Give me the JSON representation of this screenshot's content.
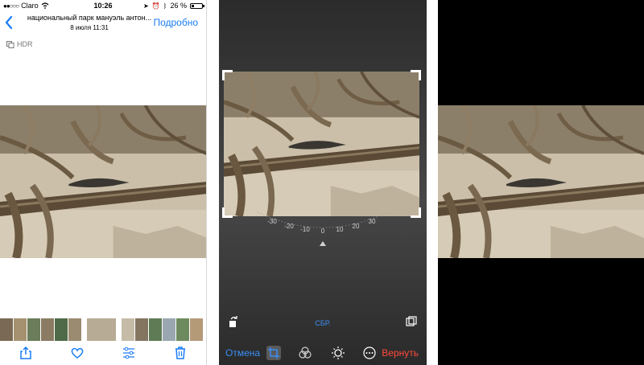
{
  "status_bar": {
    "carrier": "Claro",
    "time": "10:26",
    "battery": "26 %",
    "battery_level": 0.26
  },
  "viewer": {
    "title": "национальный парк мануэль антон...",
    "subtitle": "8 июля  11:31",
    "details_label": "Подробно",
    "hdr_label": "HDR"
  },
  "editor": {
    "cancel_label": "Отмена",
    "revert_label": "Вернуть",
    "reset_label": "СБР.",
    "dial_ticks": [
      "-30",
      "-20",
      "-10",
      "0",
      "10",
      "20",
      "30"
    ]
  },
  "colors": {
    "ios_blue": "#1a7cf5",
    "revert_red": "#ff4a3d",
    "sand": "#cfc2ad",
    "wood": "#5d4a33"
  },
  "icons": {
    "share": "share-icon",
    "like": "heart-icon",
    "edit": "adjust-sliders-icon",
    "delete": "trash-icon",
    "crop": "crop-rotate-icon",
    "filters": "filters-icon",
    "adjust": "light-dial-icon",
    "more": "more-icon",
    "rotate": "rotate-icon",
    "aspect": "aspect-ratio-icon"
  }
}
